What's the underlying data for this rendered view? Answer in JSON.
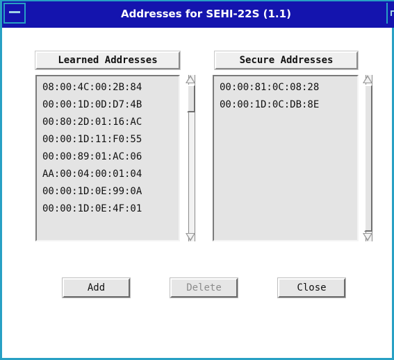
{
  "window": {
    "title": "Addresses for SEHI-22S (1.1)"
  },
  "learned": {
    "header": "Learned Addresses",
    "items": [
      "08:00:4C:00:2B:84",
      "00:00:1D:0D:D7:4B",
      "00:80:2D:01:16:AC",
      "00:00:1D:11:F0:55",
      "00:00:89:01:AC:06",
      "AA:00:04:00:01:04",
      "00:00:1D:0E:99:0A",
      "00:00:1D:0E:4F:01"
    ]
  },
  "secure": {
    "header": "Secure Addresses",
    "items": [
      "00:00:81:0C:08:28",
      "00:00:1D:0C:DB:8E"
    ]
  },
  "buttons": {
    "add": "Add",
    "delete": "Delete",
    "close": "Close"
  },
  "icons": {
    "window_menu": "window-menu-icon",
    "maximize": "maximize-icon",
    "scroll_up": "arrow-up-icon",
    "scroll_down": "arrow-down-icon"
  },
  "colors": {
    "titlebar": "#1414ae",
    "frame": "#27a0c4",
    "list_background": "#e4e4e4",
    "disabled_text": "#8c8c8c"
  }
}
